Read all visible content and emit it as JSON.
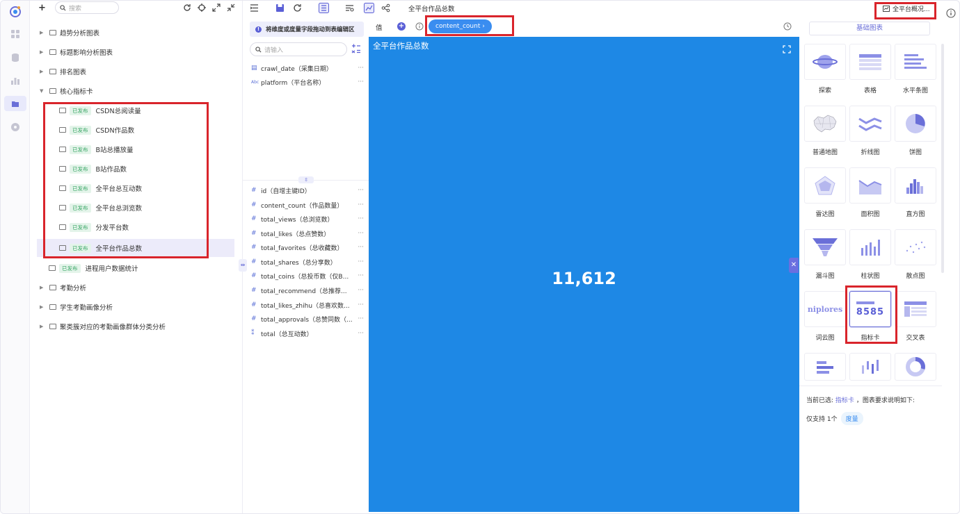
{
  "tree": {
    "search_placeholder": "搜索",
    "nodes": [
      {
        "label": "趋势分析图表"
      },
      {
        "label": "标题影响分析图表"
      },
      {
        "label": "排名图表"
      },
      {
        "label": "核心指标卡"
      }
    ],
    "children": [
      {
        "badge": "已发布",
        "label": "CSDN总阅读量"
      },
      {
        "badge": "已发布",
        "label": "CSDN作品数"
      },
      {
        "badge": "已发布",
        "label": "B站总播放量"
      },
      {
        "badge": "已发布",
        "label": "B站作品数"
      },
      {
        "badge": "已发布",
        "label": "全平台总互动数"
      },
      {
        "badge": "已发布",
        "label": "全平台总浏览数"
      },
      {
        "badge": "已发布",
        "label": "分发平台数"
      },
      {
        "badge": "已发布",
        "label": "全平台作品总数"
      }
    ],
    "extra_leaf": {
      "badge": "已发布",
      "label": "进程用户数据统计"
    },
    "tail_nodes": [
      {
        "label": "考勤分析"
      },
      {
        "label": "学生考勤画像分析"
      },
      {
        "label": "聚类簇对应的考勤画像群体分类分析"
      }
    ]
  },
  "toolbar": {
    "chart_title": "全平台作品总数",
    "overview_label": "全平台概况..."
  },
  "fields": {
    "hint": "将维度或度量字段拖动到表编辑区",
    "search_placeholder": "请输入",
    "dimensions": [
      {
        "type": "date",
        "name": "crawl_date（采集日期）"
      },
      {
        "type": "text",
        "name": "platform（平台名称）"
      }
    ],
    "measures": [
      {
        "name": "id（自增主键ID）"
      },
      {
        "name": "content_count（作品数量）"
      },
      {
        "name": "total_views（总浏览数）"
      },
      {
        "name": "total_likes（总点赞数）"
      },
      {
        "name": "total_favorites（总收藏数）"
      },
      {
        "name": "total_shares（总分享数）"
      },
      {
        "name": "total_coins（总投币数（仅B..."
      },
      {
        "name": "total_recommend（总推荐..."
      },
      {
        "name": "total_likes_zhihu（总喜欢数..."
      },
      {
        "name": "total_approvals（总赞同数（..."
      },
      {
        "name": "total（总互动数）"
      }
    ],
    "more": "···"
  },
  "value_bar": {
    "label": "值",
    "pill": "content_count ›"
  },
  "canvas": {
    "title": "全平台作品总数",
    "kpi_value": "11,612",
    "bg_color": "#1e88e5"
  },
  "chart_types": {
    "tab": "基础图表",
    "items": [
      {
        "label": "探索"
      },
      {
        "label": "表格"
      },
      {
        "label": "水平条图"
      },
      {
        "label": "普通地图"
      },
      {
        "label": "折线图"
      },
      {
        "label": "饼图"
      },
      {
        "label": "雷达图"
      },
      {
        "label": "面积图"
      },
      {
        "label": "直方图"
      },
      {
        "label": "漏斗图"
      },
      {
        "label": "柱状图"
      },
      {
        "label": "散点图"
      },
      {
        "label": "词云图"
      },
      {
        "label": "指标卡"
      },
      {
        "label": "交叉表"
      }
    ],
    "kpi_sample": "8585",
    "wordcloud_sample": "niplores",
    "desc_prefix": "当前已选:",
    "desc_selected": "指标卡",
    "desc_suffix": "，图表要求说明如下:",
    "desc_support": "仅支持 1个",
    "desc_tag": "度量"
  },
  "accent_color": "#6a6fd8"
}
